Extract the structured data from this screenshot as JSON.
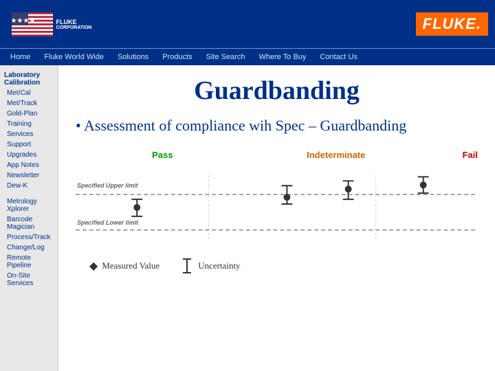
{
  "header": {
    "fluke_logo": "FLUKE.",
    "nav_items": [
      "Home",
      "Fluke World Wide",
      "Solutions",
      "Products",
      "Site Search",
      "Where To Buy",
      "Contact Us"
    ]
  },
  "sidebar": {
    "section1": {
      "label": "Laboratory Calibration",
      "items": [
        "Met/Cal",
        "Met/Track",
        "Gold-Plan",
        "Training",
        "Services",
        "Support",
        "Upgrades",
        "App Notes",
        "Newsletter",
        "Dew-K"
      ]
    },
    "section2": {
      "items": [
        "Metrology Xplorer",
        "Barcode Magician",
        "Process/Track",
        "Change/Log",
        "Remote Pipeline",
        "On-Site Services"
      ]
    }
  },
  "main": {
    "title": "Guardbanding",
    "bullet": "• Assessment of compliance wih Spec – Guardbanding",
    "zones": {
      "pass": "Pass",
      "indeterminate": "Indeterminate",
      "fail": "Fail"
    },
    "limits": {
      "upper": "Specified Upper limit",
      "lower": "Specified Lower limit"
    },
    "legend": {
      "measured_value": "Measured Value",
      "uncertainty": "Uncertainty"
    }
  }
}
